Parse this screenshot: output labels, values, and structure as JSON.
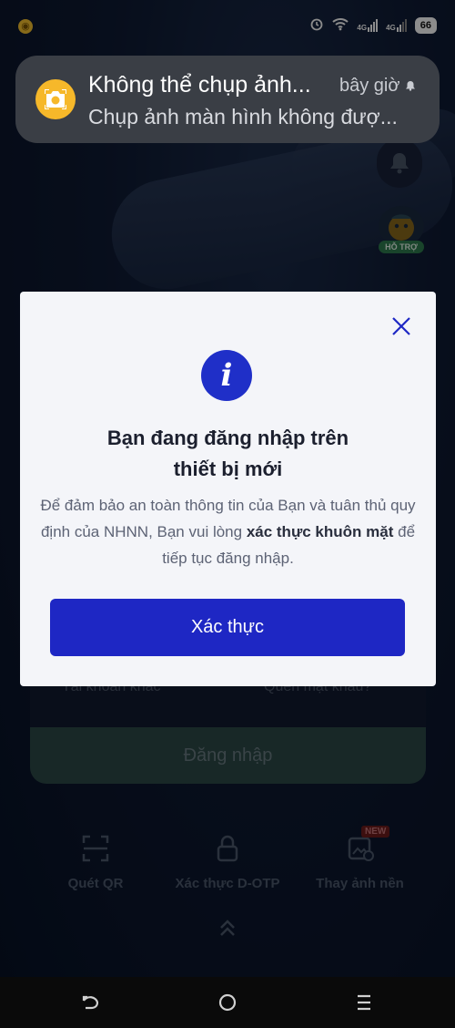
{
  "status_bar": {
    "signal1": "4G",
    "signal2": "4G",
    "battery": "66"
  },
  "notification": {
    "title": "Không thể chụp ảnh...",
    "time": "bây giờ",
    "body": "Chụp ảnh màn hình không đượ...",
    "icon": "camera-icon",
    "accent": "#f6b82a"
  },
  "side": {
    "support_label": "HỖ TRỢ"
  },
  "background_form": {
    "other_account": "Tài khoản khác",
    "forgot_password": "Quên mật khẩu?",
    "login_label": "Đăng nhập"
  },
  "quick_actions": [
    {
      "label": "Quét QR",
      "icon": "qr-scan-icon"
    },
    {
      "label": "Xác thực D-OTP",
      "icon": "lock-icon"
    },
    {
      "label": "Thay ảnh nền",
      "icon": "image-change-icon",
      "badge": "NEW"
    }
  ],
  "modal": {
    "title_line1": "Bạn đang đăng nhập trên",
    "title_line2": "thiết bị mới",
    "body_part1": "Để đảm bảo an toàn thông tin của Bạn và tuân thủ quy định của NHNN, Bạn vui lòng ",
    "body_bold": "xác thực khuôn mặt",
    "body_part2": " để tiếp tục đăng nhập.",
    "button_label": "Xác thực",
    "accent": "#1e27c4"
  }
}
